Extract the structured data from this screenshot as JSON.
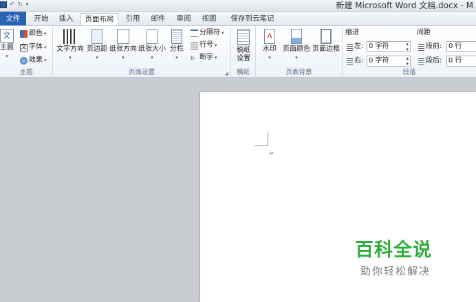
{
  "window": {
    "title": "新建 Microsoft Word 文档.docx - M"
  },
  "tabs": [
    "文件",
    "开始",
    "插入",
    "页面布局",
    "引用",
    "邮件",
    "审阅",
    "视图",
    "保存到云笔记"
  ],
  "active_tab": "页面布局",
  "ribbon": {
    "theme_group": {
      "label": "主题",
      "theme_button": "主题",
      "colors": "颜色",
      "fonts": "字体",
      "effects": "效果",
      "theme_icon_text": "文"
    },
    "page_setup": {
      "label": "页面设置",
      "text_direction": "文字方向",
      "margins": "页边距",
      "orientation": "纸张方向",
      "size": "纸张大小",
      "columns": "分栏",
      "breaks": "分隔符",
      "line_numbers": "行号",
      "hyphenation": "断字"
    },
    "draft": {
      "label": "稿纸",
      "button_line1": "稿纸",
      "button_line2": "设置"
    },
    "page_background": {
      "label": "页面背景",
      "watermark": "水印",
      "page_color": "页面颜色",
      "page_borders": "页面边框"
    },
    "paragraph": {
      "label": "段落",
      "indent_title": "缩进",
      "left_label": "左:",
      "left_value": "0 字符",
      "right_label": "右:",
      "right_value": "0 字符",
      "spacing_title": "间距",
      "before_label": "段前:",
      "before_value": "0 行",
      "after_label": "段后:",
      "after_value": "0 行"
    }
  },
  "document": {
    "paragraph_mark": "↵"
  },
  "watermark": {
    "title": "百科全说",
    "subtitle": "助你轻松解决"
  },
  "colors": {
    "file_tab": "#2b63b4",
    "watermark_green": "#2fae3d",
    "accent": "#2b5797"
  }
}
